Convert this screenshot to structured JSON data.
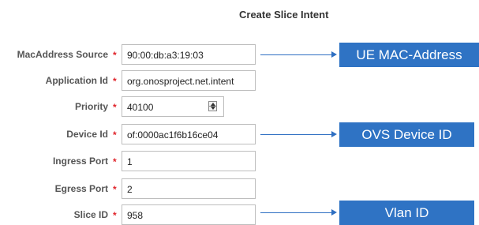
{
  "form": {
    "title": "Create Slice Intent",
    "required_marker": "*",
    "fields": [
      {
        "label": "MacAddress Source",
        "value": "90:00:db:a3:19:03"
      },
      {
        "label": "Application Id",
        "value": "org.onosproject.net.intent"
      },
      {
        "label": "Priority",
        "value": "40100"
      },
      {
        "label": "Device Id",
        "value": "of:0000ac1f6b16ce04"
      },
      {
        "label": "Ingress Port",
        "value": "1"
      },
      {
        "label": "Egress Port",
        "value": "2"
      },
      {
        "label": "Slice ID",
        "value": "958"
      }
    ]
  },
  "callouts": {
    "mac": "UE MAC-Address",
    "device": "OVS Device ID",
    "vlan": "Vlan ID"
  },
  "colors": {
    "callout_bg": "#2f73c4",
    "arrow": "#2e6fc2",
    "required": "#e0242b"
  }
}
